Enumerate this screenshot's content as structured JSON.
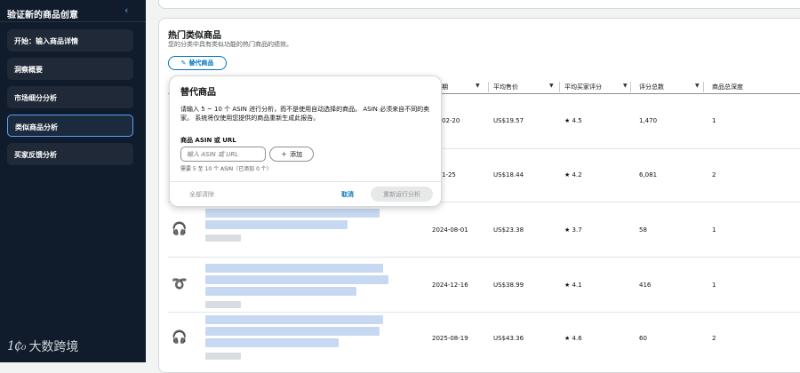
{
  "sidebar": {
    "title": "验证新的商品创意",
    "items": [
      {
        "label": "开始：输入商品详情"
      },
      {
        "label": "洞察概要"
      },
      {
        "label": "市场细分分析"
      },
      {
        "label": "类似商品分析"
      },
      {
        "label": "买家反馈分析"
      }
    ],
    "active_index": 3,
    "logo_mark": "1₵₀",
    "logo_text": "大数跨境"
  },
  "section": {
    "title": "热门类似商品",
    "subtitle": "您的分类中具有类似功能的热门商品的绩效。",
    "alt_button": "替代商品"
  },
  "table": {
    "headers": [
      "期",
      "平均售价",
      "平均买家评分",
      "评分总数",
      "商品总深度"
    ],
    "rows": [
      {
        "date": "02-20",
        "price": "US$19.57",
        "rating": "4.5",
        "count": "1,470",
        "depth": "1",
        "icon": "product-thumb"
      },
      {
        "date": "1-25",
        "price": "US$18.44",
        "rating": "4.2",
        "count": "6,081",
        "depth": "2",
        "icon": "product-thumb"
      },
      {
        "date": "2024-08-01",
        "price": "US$23.38",
        "rating": "3.7",
        "count": "58",
        "depth": "1",
        "icon": "headphones-icon"
      },
      {
        "date": "2024-12-16",
        "price": "US$38.99",
        "rating": "4.1",
        "count": "416",
        "depth": "1",
        "icon": "earbuds-icon"
      },
      {
        "date": "2025-08-19",
        "price": "US$43.36",
        "rating": "4.6",
        "count": "60",
        "depth": "2",
        "icon": "headphones-icon"
      }
    ]
  },
  "popover": {
    "title": "替代商品",
    "description": "请输入 5 ~ 10 个 ASIN 进行分析，而不是使用自动选择的商品。 ASIN 必须来自不同的卖家。 系统将仅使用您提供的商品重新生成此报告。",
    "field_label": "商品 ASIN 或 URL",
    "input_placeholder": "输入 ASIN 或 URL",
    "add_label": "添加",
    "hint": "需要 5 至 10 个 ASIN（已添加 0 个）",
    "clear_all": "全部清除",
    "cancel": "取消",
    "rerun": "重新运行分析"
  },
  "colors": {
    "sidebar_bg": "#101c2b",
    "accent": "#0073bb",
    "active_border": "#5aa0ff"
  }
}
